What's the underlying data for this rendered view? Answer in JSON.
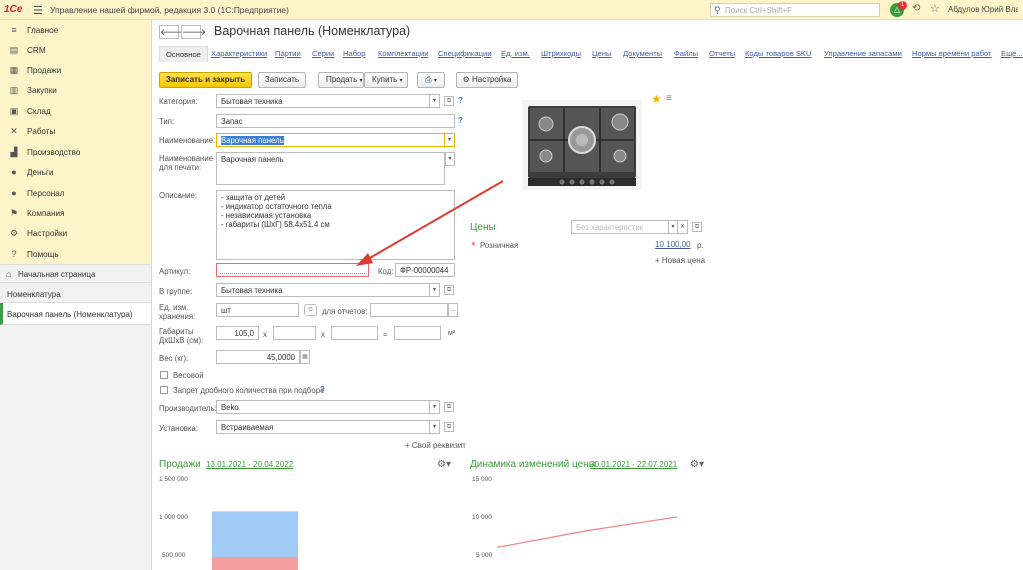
{
  "topbar": {
    "logo": "1Сe",
    "app_title": "Управление нашей фирмой, редакция 3.0  (1С:Предприятие)",
    "search_placeholder": "Поиск Ctrl+Shift+F",
    "notification_count": "1",
    "user_name": "Абдулов Юрий Владимирович"
  },
  "sidebar": {
    "items": [
      {
        "label": "Главное",
        "icon": "menu-icon"
      },
      {
        "label": "CRM",
        "icon": "crm-icon"
      },
      {
        "label": "Продажи",
        "icon": "cart-icon"
      },
      {
        "label": "Закупки",
        "icon": "purchase-icon"
      },
      {
        "label": "Склад",
        "icon": "warehouse-icon"
      },
      {
        "label": "Работы",
        "icon": "tools-icon"
      },
      {
        "label": "Производство",
        "icon": "factory-icon"
      },
      {
        "label": "Деньги",
        "icon": "money-icon"
      },
      {
        "label": "Персонал",
        "icon": "people-icon"
      },
      {
        "label": "Компания",
        "icon": "flag-icon"
      },
      {
        "label": "Настройки",
        "icon": "gear-icon"
      },
      {
        "label": "Помощь",
        "icon": "help-icon"
      }
    ],
    "home": "Начальная страница",
    "open_windows": [
      "Номенклатура",
      "Варочная панель (Номенклатура)"
    ]
  },
  "header": {
    "title": "Варочная панель (Номенклатура)"
  },
  "tabs": [
    "Основное",
    "Характеристики",
    "Партии",
    "Серии",
    "Набор",
    "Комплектации",
    "Спецификации",
    "Ед. изм.",
    "Штрихкоды",
    "Цены",
    "Документы",
    "Файлы",
    "Отчеты",
    "Коды товаров SKU",
    "Управление запасами",
    "Нормы времени работ",
    "Еще..."
  ],
  "toolbar": {
    "save_close": "Записать и закрыть",
    "save": "Записать",
    "sell": "Продать",
    "buy": "Купить",
    "print_icon": "printer-icon",
    "settings": "Настройка"
  },
  "form": {
    "category_label": "Категория:",
    "category_value": "Бытовая техника",
    "type_label": "Тип:",
    "type_value": "Запас",
    "name_label": "Наименование:",
    "name_value": "Варочная панель",
    "print_name_label_1": "Наименование",
    "print_name_label_2": "для печати:",
    "print_name_value": "Варочная панель",
    "description_label": "Описание:",
    "description_lines": [
      "- защита от детей",
      "- индикатор остаточного тепла",
      "- независимая установка",
      "- габариты (ШхГ) 58.4x51.4 см"
    ],
    "article_label": "Артикул:",
    "article_value": "",
    "code_label": "Код:",
    "code_value": "ФР-00000044",
    "group_label": "В группе:",
    "group_value": "Бытовая техника",
    "unit_label_1": "Ед. изм.",
    "unit_label_2": "хранения:",
    "unit_value": "шт",
    "reports_label": "для отчетов:",
    "reports_value": "",
    "dims_label_1": "Габариты",
    "dims_label_2": "ДхШхВ (см):",
    "dim1": "105,0",
    "dim_x1": "x",
    "dim_x2": "x",
    "dim_eq": "=",
    "dim_unit": "м³",
    "weight_label": "Вес (кг):",
    "weight_value": "45,0000",
    "weighted_label": "Весовой",
    "fraction_label": "Запрет дробного количества при подборе",
    "manufacturer_label": "Производитель:",
    "manufacturer_value": "Beko",
    "install_label": "Установка:",
    "install_value": "Встраиваемая",
    "add_prop": "+ Свой реквизит"
  },
  "prices": {
    "title": "Цены",
    "characteristic_placeholder": "Без характеристик",
    "retail_label": "Розничная",
    "retail_value": "10 100,00",
    "currency": "р.",
    "new_price": "+ Новая цена"
  },
  "sales": {
    "title": "Продажи",
    "period": "13.01.2021 - 20.04.2022",
    "colors": {
      "top": "#9fcbf5",
      "bottom": "#f4a0a0"
    }
  },
  "dynamics": {
    "title": "Динамика изменений цены",
    "period": "30.01.2021 - 22.07.2021",
    "color": "#ef8a8a"
  },
  "chart_data": [
    {
      "type": "bar",
      "title": "Продажи",
      "yticks": [
        "1 500 000",
        "1 000 000",
        "500 000"
      ],
      "ylim": [
        0,
        1500000
      ],
      "series": [
        {
          "values": [
            500000
          ]
        },
        {
          "values": [
            600000
          ]
        }
      ]
    },
    {
      "type": "line",
      "title": "Динамика изменений цены",
      "yticks": [
        "15 000",
        "10 000",
        "5 000"
      ],
      "ylim": [
        0,
        15000
      ],
      "series": [
        {
          "values": [
            6000,
            8200,
            10000
          ]
        }
      ]
    }
  ]
}
